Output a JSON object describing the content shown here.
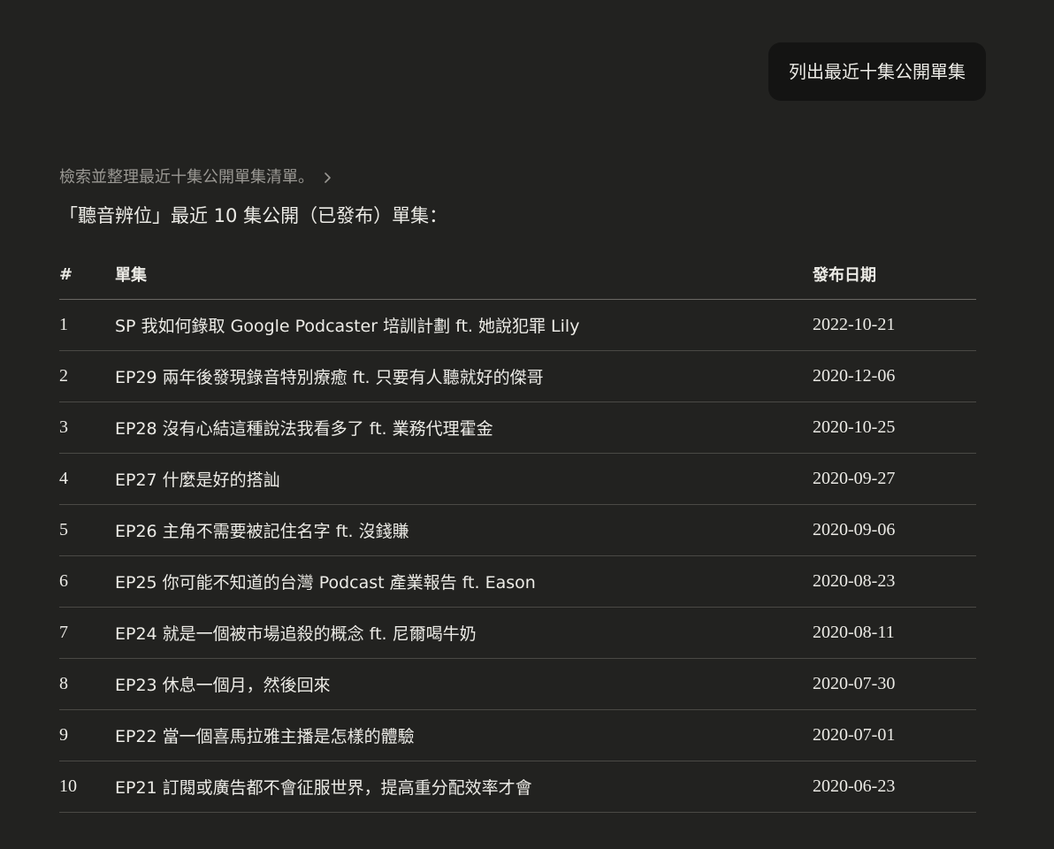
{
  "user_message": "列出最近十集公開單集",
  "thinking_summary": "檢索並整理最近十集公開單集清單。",
  "intro": "「聽音辨位」最近 10 集公開（已發布）單集：",
  "table": {
    "headers": [
      "#",
      "單集",
      "發布日期"
    ],
    "rows": [
      {
        "num": "1",
        "title": "SP 我如何錄取 Google Podcaster 培訓計劃 ft. 她說犯罪 Lily",
        "date": "2022-10-21"
      },
      {
        "num": "2",
        "title": "EP29 兩年後發現錄音特別療癒 ft. 只要有人聽就好的傑哥",
        "date": "2020-12-06"
      },
      {
        "num": "3",
        "title": "EP28 沒有心結這種說法我看多了 ft. 業務代理霍金",
        "date": "2020-10-25"
      },
      {
        "num": "4",
        "title": "EP27 什麼是好的搭訕",
        "date": "2020-09-27"
      },
      {
        "num": "5",
        "title": "EP26 主角不需要被記住名字 ft. 沒錢賺",
        "date": "2020-09-06"
      },
      {
        "num": "6",
        "title": "EP25 你可能不知道的台灣 Podcast 產業報告 ft. Eason",
        "date": "2020-08-23"
      },
      {
        "num": "7",
        "title": "EP24 就是一個被市場追殺的概念 ft. 尼爾喝牛奶",
        "date": "2020-08-11"
      },
      {
        "num": "8",
        "title": "EP23 休息一個月，然後回來",
        "date": "2020-07-30"
      },
      {
        "num": "9",
        "title": "EP22 當一個喜馬拉雅主播是怎樣的體驗",
        "date": "2020-07-01"
      },
      {
        "num": "10",
        "title": "EP21 訂閱或廣告都不會征服世界，提高重分配效率才會",
        "date": "2020-06-23"
      }
    ]
  }
}
